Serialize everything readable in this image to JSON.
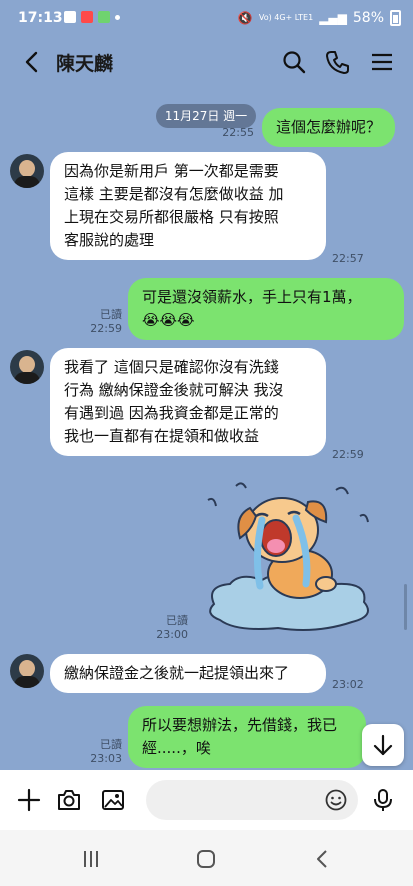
{
  "status_bar": {
    "time": "17:13",
    "network": "Vo) 4G+ LTE1",
    "battery": "58%"
  },
  "header": {
    "contact_name": "陳天麟"
  },
  "chat": {
    "date_pill": "11月27日 週一",
    "messages": [
      {
        "dir": "out",
        "text": "這個怎麼辦呢？",
        "time": "22:55",
        "read": ""
      },
      {
        "dir": "in",
        "lines": [
          "因為你是新用戶 第一次都是需要",
          "這樣 主要是都沒有怎麼做收益 加",
          "上現在交易所都很嚴格 只有按照",
          "客服說的處理"
        ],
        "time": "22:57"
      },
      {
        "dir": "out",
        "lines": [
          "可是還沒領薪水，手上只有1萬，",
          "😭😭😭"
        ],
        "time": "22:59",
        "read": "已讀"
      },
      {
        "dir": "in",
        "lines": [
          "我看了 這個只是確認你沒有洗錢",
          "行為 繳納保證金後就可解決 我沒",
          "有遇到過 因為我資金都是正常的",
          "我也一直都有在提領和做收益"
        ],
        "time": "22:59"
      },
      {
        "dir": "out",
        "type": "sticker",
        "sticker": "crying-dog-sticker",
        "time": "23:00",
        "read": "已讀"
      },
      {
        "dir": "in",
        "text": "繳納保證金之後就一起提領出來了",
        "time": "23:02"
      },
      {
        "dir": "out",
        "lines": [
          "所以要想辦法，先借錢，我已",
          "經.....，唉"
        ],
        "time": "23:03",
        "read": "已讀"
      }
    ]
  },
  "input": {
    "placeholder": ""
  },
  "colors": {
    "chat_bg": "#8aa6cf",
    "incoming": "#ffffff",
    "outgoing": "#7ce36f"
  }
}
